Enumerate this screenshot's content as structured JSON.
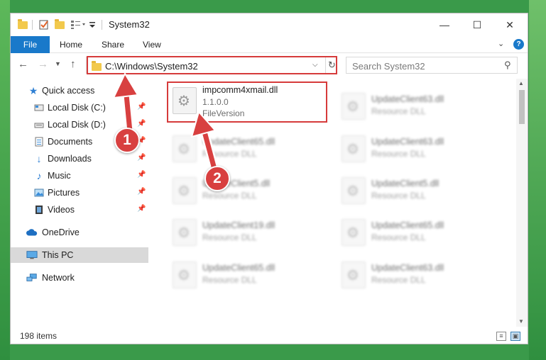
{
  "window": {
    "title": "System32",
    "controls": {
      "minimize": "—",
      "maximize": "☐",
      "close": "✕"
    }
  },
  "ribbon": {
    "tabs": [
      "File",
      "Home",
      "Share",
      "View"
    ],
    "expand_icon": "chevron-down-icon",
    "help_label": "?"
  },
  "address": {
    "path": "C:\\Windows\\System32",
    "search_placeholder": "Search System32"
  },
  "sidebar": {
    "items": [
      {
        "label": "Quick access",
        "icon": "star-icon"
      },
      {
        "label": "Local Disk (C:)",
        "icon": "drive-icon",
        "pinned": true
      },
      {
        "label": "Local Disk (D:)",
        "icon": "drive-icon",
        "pinned": true
      },
      {
        "label": "Documents",
        "icon": "documents-icon",
        "pinned": true
      },
      {
        "label": "Downloads",
        "icon": "download-icon",
        "pinned": true
      },
      {
        "label": "Music",
        "icon": "music-icon",
        "pinned": true
      },
      {
        "label": "Pictures",
        "icon": "pictures-icon",
        "pinned": true
      },
      {
        "label": "Videos",
        "icon": "videos-icon",
        "pinned": true
      },
      {
        "label": "OneDrive",
        "icon": "cloud-icon"
      },
      {
        "label": "This PC",
        "icon": "computer-icon",
        "selected": true
      },
      {
        "label": "Network",
        "icon": "network-icon"
      }
    ]
  },
  "files": {
    "highlighted": {
      "name": "impcomm4xmail.dll",
      "version": "1.1.0.0",
      "description": "FileVersion"
    },
    "blurred": [
      {
        "name": "UpdateClient63.dll",
        "description": "Resource DLL"
      },
      {
        "name": "UpdateClient65.dll",
        "description": "Resource DLL"
      },
      {
        "name": "UpdateClient63.dll",
        "description": "Resource DLL"
      },
      {
        "name": "UpdateClient5.dll",
        "description": "Resource DLL"
      },
      {
        "name": "UpdateClient5.dll",
        "description": "Resource DLL"
      },
      {
        "name": "UpdateClient19.dll",
        "description": "Resource DLL"
      },
      {
        "name": "UpdateClient65.dll",
        "description": "Resource DLL"
      },
      {
        "name": "UpdateClient65.dll",
        "description": "Resource DLL"
      },
      {
        "name": "UpdateClient63.dll",
        "description": "Resource DLL"
      }
    ]
  },
  "status": {
    "item_count": "198 items"
  },
  "annotations": {
    "step1": "1",
    "step2": "2",
    "color": "#d63b3b"
  }
}
